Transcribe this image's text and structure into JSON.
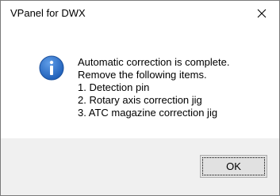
{
  "window": {
    "title": "VPanel for DWX"
  },
  "message": {
    "lines": [
      "Automatic correction is complete.",
      "Remove the following items.",
      "1. Detection pin",
      "2. Rotary axis correction jig",
      "3. ATC magazine correction jig"
    ]
  },
  "buttons": {
    "ok_label": "OK"
  },
  "icons": {
    "close": "close-icon",
    "info": "info-icon"
  },
  "colors": {
    "info_icon": "#2b6cc4",
    "footer_bg": "#f0f0f0"
  }
}
